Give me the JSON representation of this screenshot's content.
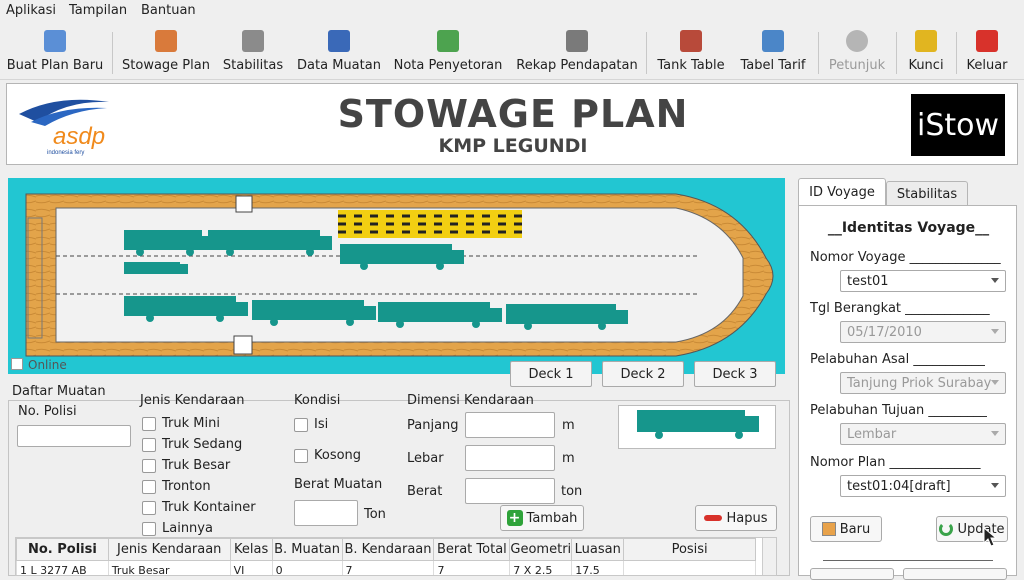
{
  "menu": [
    "Aplikasi",
    "Tampilan",
    "Bantuan"
  ],
  "toolbar": [
    {
      "label": "Buat Plan Baru",
      "icon": "new-plan-icon",
      "color": "#5b8fd6"
    },
    {
      "label": "Stowage Plan",
      "icon": "stowage-plan-icon",
      "color": "#d97a3b"
    },
    {
      "label": "Stabilitas",
      "icon": "stability-icon",
      "color": "#8b8b8b"
    },
    {
      "label": "Data Muatan",
      "icon": "cargo-data-icon",
      "color": "#3a69b8"
    },
    {
      "label": "Nota Penyetoran",
      "icon": "deposit-note-icon",
      "color": "#4da34f"
    },
    {
      "label": "Rekap Pendapatan",
      "icon": "revenue-recap-icon",
      "color": "#7a7a7a"
    },
    {
      "label": "Tank Table",
      "icon": "tank-table-icon",
      "color": "#b84a3a"
    },
    {
      "label": "Tabel Tarif",
      "icon": "tariff-table-icon",
      "color": "#4b86c8"
    },
    {
      "label": "Petunjuk",
      "icon": "help-icon",
      "color": "#9e9e9e"
    },
    {
      "label": "Kunci",
      "icon": "lock-icon",
      "color": "#e1b520"
    },
    {
      "label": "Keluar",
      "icon": "exit-icon",
      "color": "#d8322b"
    }
  ],
  "header": {
    "title": "STOWAGE PLAN",
    "subtitle": "KMP LEGUNDI",
    "logo_text": "asdp",
    "logo_sub": "indonesia fery",
    "brand": "iStow"
  },
  "plan": {
    "online_label": "Online",
    "decks": [
      "Deck 1",
      "Deck 2",
      "Deck 3"
    ]
  },
  "form": {
    "list_title": "Daftar Muatan",
    "no_polisi_label": "No. Polisi",
    "jenis_label": "Jenis Kendaraan",
    "jenis_options": [
      "Truk Mini",
      "Truk Sedang",
      "Truk Besar",
      "Tronton",
      "Truk Kontainer",
      "Lainnya"
    ],
    "kondisi_label": "Kondisi",
    "kondisi_options": [
      "Isi",
      "Kosong"
    ],
    "berat_label": "Berat Muatan",
    "berat_unit": "Ton",
    "dimensi_label": "Dimensi Kendaraan",
    "panjang_label": "Panjang",
    "lebar_label": "Lebar",
    "berat2_label": "Berat",
    "unit_m": "m",
    "unit_ton": "ton",
    "tambah": "Tambah",
    "hapus": "Hapus"
  },
  "table": {
    "headers": [
      "No. Polisi",
      "Jenis Kendaraan",
      "Kelas",
      "B. Muatan",
      "B. Kendaraan",
      "Berat Total",
      "Geometri",
      "Luasan",
      "Posisi"
    ],
    "rows": [
      [
        "1",
        "L 3277 AB",
        "Truk Besar",
        "VI",
        "0",
        "7",
        "7",
        "7 X 2.5",
        "17.5",
        ""
      ]
    ]
  },
  "right": {
    "tabs": [
      "ID Voyage",
      "Stabilitas"
    ],
    "title": "__Identitas Voyage__",
    "nomor_voyage_label": "Nomor Voyage ______________",
    "nomor_voyage": "test01",
    "tgl_label": "Tgl Berangkat _____________",
    "tgl": "05/17/2010",
    "asal_label": "Pelabuhan Asal ___________",
    "asal": "Tanjung Priok Surabay",
    "tujuan_label": "Pelabuhan Tujuan _________",
    "tujuan": "Lembar",
    "plan_label": "Nomor Plan ______________",
    "plan": "test01:04[draft]",
    "baru": "Baru",
    "update": "Update"
  }
}
